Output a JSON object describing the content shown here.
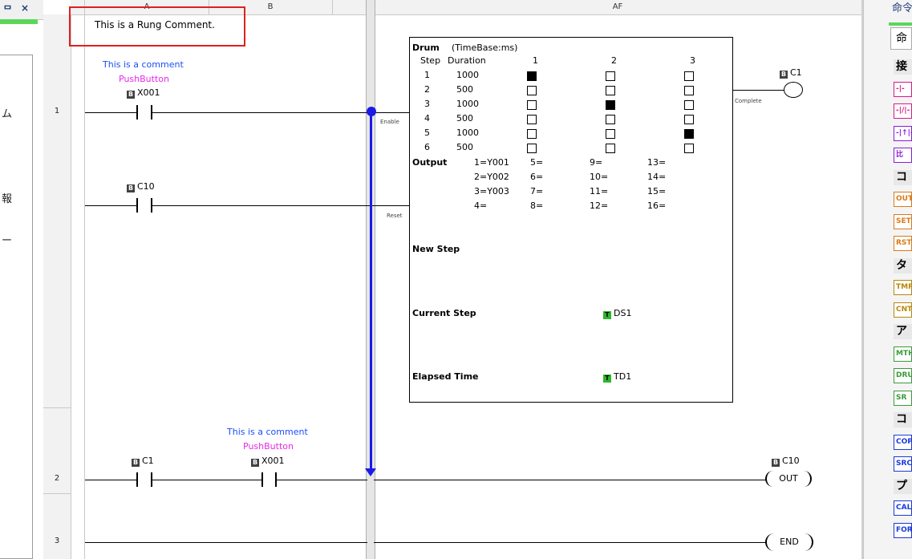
{
  "left_panel": {
    "header_label": "ᄆ",
    "close_label": "×",
    "text_items": [
      "ム",
      "報",
      "ー"
    ]
  },
  "columns": {
    "a": "A",
    "b": "B",
    "af": "AF"
  },
  "rung_comment": "This is a Rung Comment.",
  "rungs": {
    "r1": "1",
    "r2": "2",
    "r3": "3"
  },
  "rung1": {
    "contact1": {
      "comment": "This is a comment",
      "nickname": "PushButton",
      "address": "X001"
    },
    "contact2": {
      "address": "C10"
    },
    "enable_label": "Enable",
    "reset_label": "Reset",
    "complete_label": "Complete",
    "coil": {
      "address": "C1"
    }
  },
  "drum": {
    "title": "Drum",
    "timebase": "(TimeBase:ms)",
    "step_header": "Step",
    "duration_header": "Duration",
    "columns": [
      "1",
      "2",
      "3"
    ],
    "steps": [
      {
        "step": "1",
        "duration": "1000",
        "active": [
          true,
          false,
          false
        ]
      },
      {
        "step": "2",
        "duration": "500",
        "active": [
          false,
          false,
          false
        ]
      },
      {
        "step": "3",
        "duration": "1000",
        "active": [
          false,
          true,
          false
        ]
      },
      {
        "step": "4",
        "duration": "500",
        "active": [
          false,
          false,
          false
        ]
      },
      {
        "step": "5",
        "duration": "1000",
        "active": [
          false,
          false,
          true
        ]
      },
      {
        "step": "6",
        "duration": "500",
        "active": [
          false,
          false,
          false
        ]
      }
    ],
    "output_label": "Output",
    "outputs": [
      "1=Y001",
      "2=Y002",
      "3=Y003",
      "4=",
      "5=",
      "6=",
      "7=",
      "8=",
      "9=",
      "10=",
      "11=",
      "12=",
      "13=",
      "14=",
      "15=",
      "16="
    ],
    "new_step_label": "New Step",
    "current_step_label": "Current Step",
    "current_step_addr": "DS1",
    "elapsed_label": "Elapsed Time",
    "elapsed_addr": "TD1"
  },
  "rung2": {
    "contact1": {
      "address": "C1"
    },
    "contact2": {
      "comment": "This is a comment",
      "nickname": "PushButton",
      "address": "X001"
    },
    "coil_address": "C10",
    "coil_label": "OUT"
  },
  "rung3": {
    "coil_label": "END"
  },
  "right_panel": {
    "title": "命令",
    "tab": "命",
    "items": [
      {
        "kind": "cat",
        "label": "接"
      },
      {
        "kind": "item",
        "label": "-|-",
        "color": "#d81b8a"
      },
      {
        "kind": "item",
        "label": "-|/|-",
        "color": "#d81b8a"
      },
      {
        "kind": "item",
        "label": "-|↑|-",
        "color": "#8a1bd8"
      },
      {
        "kind": "item",
        "label": "比",
        "color": "#8a1bd8"
      },
      {
        "kind": "cat",
        "label": "コ"
      },
      {
        "kind": "item",
        "label": "OUT",
        "color": "#d87a1b"
      },
      {
        "kind": "item",
        "label": "SET",
        "color": "#d87a1b"
      },
      {
        "kind": "item",
        "label": "RST",
        "color": "#d87a1b"
      },
      {
        "kind": "cat",
        "label": "タ"
      },
      {
        "kind": "item",
        "label": "TMR",
        "color": "#b8860b"
      },
      {
        "kind": "item",
        "label": "CNT",
        "color": "#b8860b"
      },
      {
        "kind": "cat",
        "label": "ア"
      },
      {
        "kind": "item",
        "label": "MTH",
        "color": "#3a9a3a"
      },
      {
        "kind": "item",
        "label": "DRUM",
        "color": "#3a9a3a"
      },
      {
        "kind": "item",
        "label": "SR",
        "color": "#3a9a3a"
      },
      {
        "kind": "cat",
        "label": "コ"
      },
      {
        "kind": "item",
        "label": "COPY",
        "color": "#1b3ad8"
      },
      {
        "kind": "item",
        "label": "SRCH",
        "color": "#1b3ad8"
      },
      {
        "kind": "cat",
        "label": "プ"
      },
      {
        "kind": "item",
        "label": "CALL",
        "color": "#1b3ad8"
      },
      {
        "kind": "item",
        "label": "FOR",
        "color": "#1b3ad8"
      }
    ]
  }
}
